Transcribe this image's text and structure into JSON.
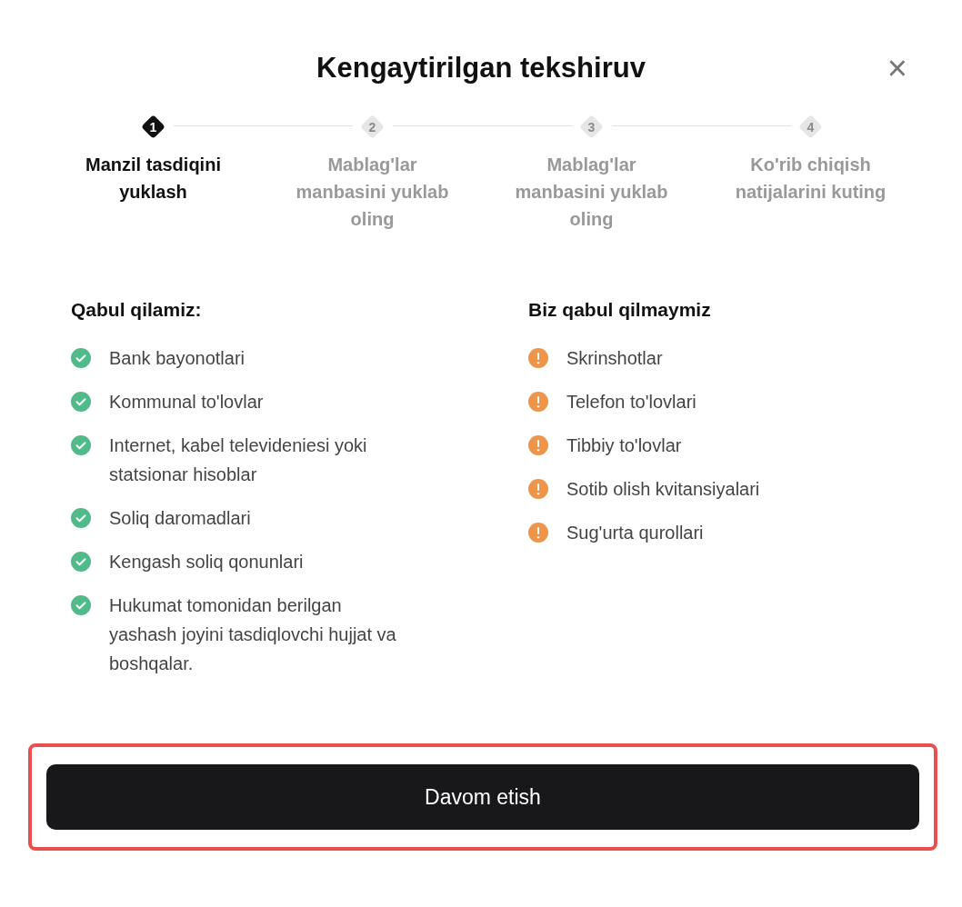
{
  "dialog": {
    "title": "Kengaytirilgan tekshiruv",
    "close": "×"
  },
  "steps": [
    {
      "number": "1",
      "label": "Manzil tasdiqini yuklash",
      "selected": true
    },
    {
      "number": "2",
      "label": "Mablag'lar manbasini yuklab oling",
      "selected": false
    },
    {
      "number": "3",
      "label": "Mablag'lar manbasini yuklab oling",
      "selected": false
    },
    {
      "number": "4",
      "label": "Ko'rib chiqish natijalarini kuting",
      "selected": false
    }
  ],
  "lists": [
    {
      "heading": "Qabul qilamiz:",
      "kind": "accepted",
      "items": [
        "Bank bayonotlari",
        "Kommunal to'lovlar",
        "Internet, kabel televideniesi yoki statsionar hisoblar",
        "Soliq daromadlari",
        "Kengash soliq qonunlari",
        "Hukumat tomonidan berilgan yashash joyini tasdiqlovchi hujjat va boshqalar."
      ]
    },
    {
      "heading": "Biz qabul qilmaymiz",
      "kind": "rejected",
      "items": [
        "Skrinshotlar",
        "Telefon to'lovlari",
        "Tibbiy to'lovlar",
        "Sotib olish kvitansiyalari",
        "Sug'urta qurollari"
      ]
    }
  ],
  "button": {
    "label": "Davom etish",
    "highlighted": true
  }
}
